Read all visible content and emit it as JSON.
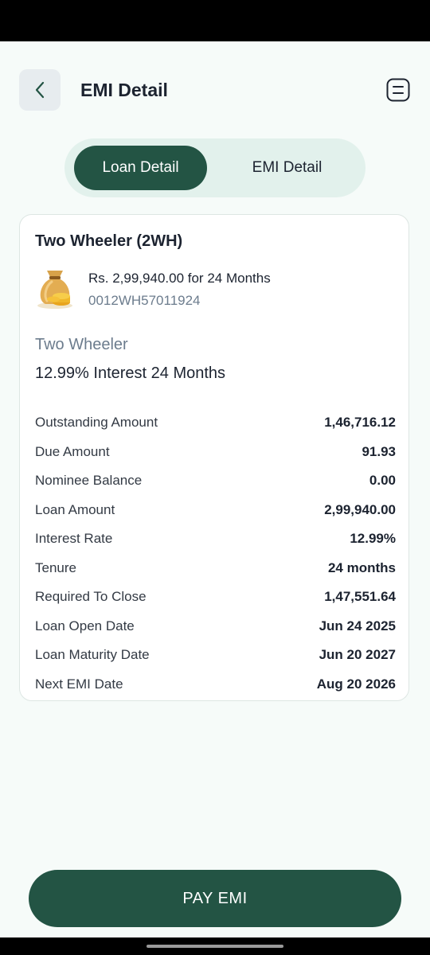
{
  "header": {
    "title": "EMI Detail",
    "back_icon": "chevron-left-icon",
    "menu_icon": "menu-icon"
  },
  "tabs": [
    {
      "label": "Loan Detail",
      "active": true
    },
    {
      "label": "EMI Detail",
      "active": false
    }
  ],
  "loan": {
    "type": "Two Wheeler (2WH)",
    "icon": "money-bag-icon",
    "summary": "Rs. 2,99,940.00 for 24 Months",
    "account_number": "0012WH57011924",
    "product": "Two Wheeler",
    "interest_line": "12.99% Interest 24 Months"
  },
  "details": [
    {
      "label": "Outstanding Amount",
      "value": "1,46,716.12"
    },
    {
      "label": "Due Amount",
      "value": "91.93"
    },
    {
      "label": "Nominee Balance",
      "value": "0.00"
    },
    {
      "label": "Loan Amount",
      "value": "2,99,940.00"
    },
    {
      "label": "Interest Rate",
      "value": "12.99%"
    },
    {
      "label": "Tenure",
      "value": "24 months"
    },
    {
      "label": "Required To Close",
      "value": "1,47,551.64"
    },
    {
      "label": "Loan Open Date",
      "value": "Jun 24 2025"
    },
    {
      "label": "Loan Maturity Date",
      "value": "Jun 20 2027"
    },
    {
      "label": "Next EMI Date",
      "value": "Aug 20 2026"
    }
  ],
  "actions": {
    "pay_label": "PAY EMI"
  },
  "colors": {
    "primary": "#235444",
    "tab_bg": "#e2f1ec",
    "page_bg": "#f6fbf9",
    "muted_text": "#6c7c8d"
  }
}
